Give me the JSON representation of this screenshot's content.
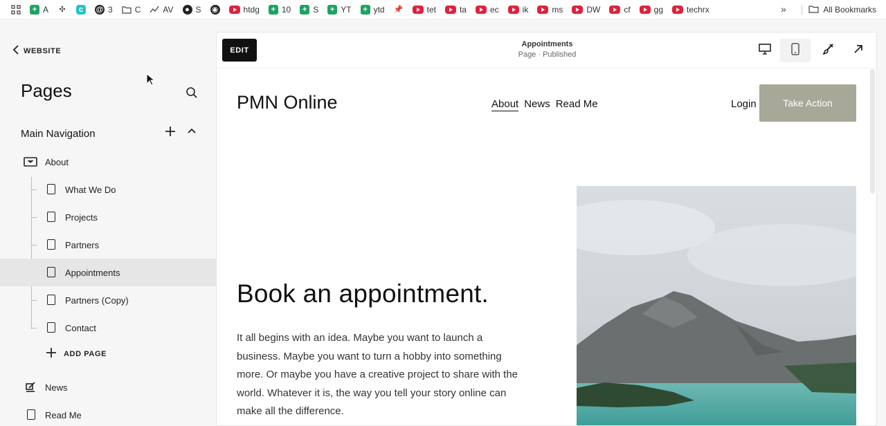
{
  "bookmarks": {
    "items": [
      {
        "icon": "apps-grid-icon",
        "label": ""
      },
      {
        "icon": "sheets-icon",
        "label": "A"
      },
      {
        "icon": "puzzle-icon",
        "label": ""
      },
      {
        "icon": "canva-icon",
        "label": ""
      },
      {
        "icon": "threads-icon",
        "label": "3"
      },
      {
        "icon": "folder-icon",
        "label": "C"
      },
      {
        "icon": "chart-line-icon",
        "label": "AV"
      },
      {
        "icon": "globe-icon",
        "label": "S"
      },
      {
        "icon": "github-icon",
        "label": ""
      },
      {
        "icon": "youtube-icon",
        "label": "htdg"
      },
      {
        "icon": "sheets-icon",
        "label": "10"
      },
      {
        "icon": "sheets-icon",
        "label": "S"
      },
      {
        "icon": "sheets-icon",
        "label": "YT"
      },
      {
        "icon": "sheets-icon",
        "label": "ytd"
      },
      {
        "icon": "pin-icon",
        "label": ""
      },
      {
        "icon": "youtube-icon",
        "label": "tet"
      },
      {
        "icon": "youtube-icon",
        "label": "ta"
      },
      {
        "icon": "youtube-icon",
        "label": "ec"
      },
      {
        "icon": "youtube-icon",
        "label": "ik"
      },
      {
        "icon": "youtube-icon",
        "label": "ms"
      },
      {
        "icon": "youtube-icon",
        "label": "DW"
      },
      {
        "icon": "youtube-icon",
        "label": "cf"
      },
      {
        "icon": "youtube-icon",
        "label": "gg"
      },
      {
        "icon": "youtube-icon",
        "label": "techrx"
      }
    ],
    "overflow_label": "»",
    "all_bookmarks": "All Bookmarks"
  },
  "sidebar": {
    "back_label": "WEBSITE",
    "title": "Pages",
    "section_title": "Main Navigation",
    "items": [
      {
        "label": "About",
        "icon": "folder-page-icon"
      },
      {
        "label": "What We Do",
        "icon": "page-icon"
      },
      {
        "label": "Projects",
        "icon": "page-icon"
      },
      {
        "label": "Partners",
        "icon": "page-icon"
      },
      {
        "label": "Appointments",
        "icon": "page-icon",
        "selected": true
      },
      {
        "label": "Partners (Copy)",
        "icon": "page-icon"
      },
      {
        "label": "Contact",
        "icon": "page-icon"
      }
    ],
    "add_page_label": "ADD PAGE",
    "extra_items": [
      {
        "label": "News",
        "icon": "blog-icon"
      },
      {
        "label": "Read Me",
        "icon": "page-icon"
      }
    ]
  },
  "editor": {
    "edit_label": "EDIT",
    "page_name": "Appointments",
    "page_status": "Page · Published"
  },
  "site": {
    "title": "PMN Online",
    "nav": [
      "About",
      "News",
      "Read Me"
    ],
    "login": "Login",
    "cta": "Take Action",
    "hero_title": "Book an appointment.",
    "hero_body": "It all begins with an idea. Maybe you want to launch a business. Maybe you want to turn a hobby into something more. Or maybe you have a creative project to share with the world. Whatever it is, the way you tell your story online can make all the difference."
  },
  "colors": {
    "cta_bg": "#a8a898",
    "selected_row": "#e6e6e6",
    "sidebar_bg": "#f6f6f6"
  }
}
